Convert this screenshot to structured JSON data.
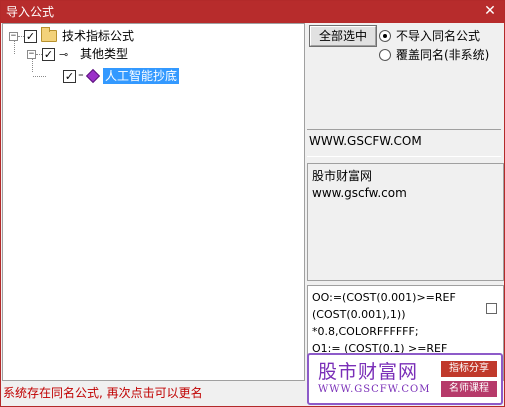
{
  "window": {
    "title": "导入公式"
  },
  "tree": {
    "root": {
      "label": "技术指标公式",
      "checked": "✓",
      "expander": "−"
    },
    "child": {
      "label": "其他类型",
      "checked": "✓",
      "expander": "−"
    },
    "leaf": {
      "label": "人工智能抄底",
      "checked": "✓"
    }
  },
  "controls": {
    "select_all_label": "全部选中",
    "radio_options": [
      {
        "label": "不导入同名公式",
        "selected": true
      },
      {
        "label": "覆盖同名(非系统)",
        "selected": false
      }
    ]
  },
  "info": {
    "url": "WWW.GSCFW.COM",
    "description_lines": [
      "股市财富网",
      "www.gscfw.com"
    ]
  },
  "code": {
    "lines": [
      "OO:=(COST(0.001)>=REF",
      "(COST(0.001),1))",
      "*0.8,COLORFFFFFF;",
      "O1:= (COST(0.1) >=REF"
    ]
  },
  "status": {
    "text": "系统存在同名公式, 再次点击可以更名"
  },
  "watermark": {
    "site_name": "股市财富网",
    "url": "WWW.GSCFW.COM",
    "tags": [
      "指标分享",
      "名师课程"
    ]
  },
  "colors": {
    "titlebar": "#b72c2c",
    "selection": "#3399ff",
    "status_text": "#c00000",
    "watermark_accent": "#7a2fb8"
  }
}
